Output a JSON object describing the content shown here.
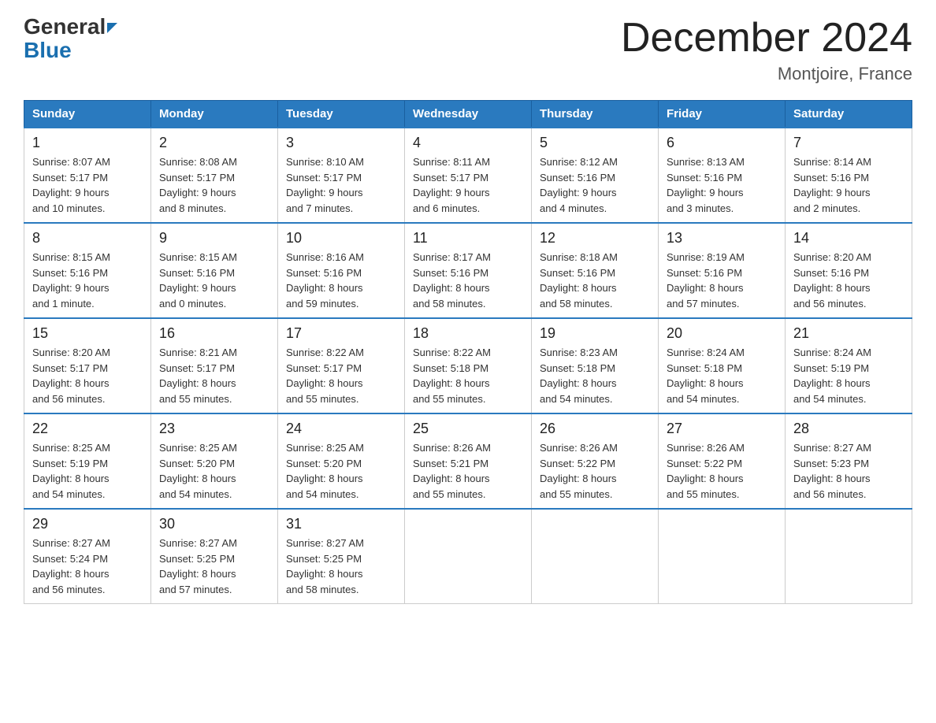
{
  "logo": {
    "general": "General",
    "blue": "Blue"
  },
  "title": "December 2024",
  "subtitle": "Montjoire, France",
  "days_of_week": [
    "Sunday",
    "Monday",
    "Tuesday",
    "Wednesday",
    "Thursday",
    "Friday",
    "Saturday"
  ],
  "weeks": [
    [
      {
        "day": "1",
        "sunrise": "8:07 AM",
        "sunset": "5:17 PM",
        "daylight": "9 hours and 10 minutes."
      },
      {
        "day": "2",
        "sunrise": "8:08 AM",
        "sunset": "5:17 PM",
        "daylight": "9 hours and 8 minutes."
      },
      {
        "day": "3",
        "sunrise": "8:10 AM",
        "sunset": "5:17 PM",
        "daylight": "9 hours and 7 minutes."
      },
      {
        "day": "4",
        "sunrise": "8:11 AM",
        "sunset": "5:17 PM",
        "daylight": "9 hours and 6 minutes."
      },
      {
        "day": "5",
        "sunrise": "8:12 AM",
        "sunset": "5:16 PM",
        "daylight": "9 hours and 4 minutes."
      },
      {
        "day": "6",
        "sunrise": "8:13 AM",
        "sunset": "5:16 PM",
        "daylight": "9 hours and 3 minutes."
      },
      {
        "day": "7",
        "sunrise": "8:14 AM",
        "sunset": "5:16 PM",
        "daylight": "9 hours and 2 minutes."
      }
    ],
    [
      {
        "day": "8",
        "sunrise": "8:15 AM",
        "sunset": "5:16 PM",
        "daylight": "9 hours and 1 minute."
      },
      {
        "day": "9",
        "sunrise": "8:15 AM",
        "sunset": "5:16 PM",
        "daylight": "9 hours and 0 minutes."
      },
      {
        "day": "10",
        "sunrise": "8:16 AM",
        "sunset": "5:16 PM",
        "daylight": "8 hours and 59 minutes."
      },
      {
        "day": "11",
        "sunrise": "8:17 AM",
        "sunset": "5:16 PM",
        "daylight": "8 hours and 58 minutes."
      },
      {
        "day": "12",
        "sunrise": "8:18 AM",
        "sunset": "5:16 PM",
        "daylight": "8 hours and 58 minutes."
      },
      {
        "day": "13",
        "sunrise": "8:19 AM",
        "sunset": "5:16 PM",
        "daylight": "8 hours and 57 minutes."
      },
      {
        "day": "14",
        "sunrise": "8:20 AM",
        "sunset": "5:16 PM",
        "daylight": "8 hours and 56 minutes."
      }
    ],
    [
      {
        "day": "15",
        "sunrise": "8:20 AM",
        "sunset": "5:17 PM",
        "daylight": "8 hours and 56 minutes."
      },
      {
        "day": "16",
        "sunrise": "8:21 AM",
        "sunset": "5:17 PM",
        "daylight": "8 hours and 55 minutes."
      },
      {
        "day": "17",
        "sunrise": "8:22 AM",
        "sunset": "5:17 PM",
        "daylight": "8 hours and 55 minutes."
      },
      {
        "day": "18",
        "sunrise": "8:22 AM",
        "sunset": "5:18 PM",
        "daylight": "8 hours and 55 minutes."
      },
      {
        "day": "19",
        "sunrise": "8:23 AM",
        "sunset": "5:18 PM",
        "daylight": "8 hours and 54 minutes."
      },
      {
        "day": "20",
        "sunrise": "8:24 AM",
        "sunset": "5:18 PM",
        "daylight": "8 hours and 54 minutes."
      },
      {
        "day": "21",
        "sunrise": "8:24 AM",
        "sunset": "5:19 PM",
        "daylight": "8 hours and 54 minutes."
      }
    ],
    [
      {
        "day": "22",
        "sunrise": "8:25 AM",
        "sunset": "5:19 PM",
        "daylight": "8 hours and 54 minutes."
      },
      {
        "day": "23",
        "sunrise": "8:25 AM",
        "sunset": "5:20 PM",
        "daylight": "8 hours and 54 minutes."
      },
      {
        "day": "24",
        "sunrise": "8:25 AM",
        "sunset": "5:20 PM",
        "daylight": "8 hours and 54 minutes."
      },
      {
        "day": "25",
        "sunrise": "8:26 AM",
        "sunset": "5:21 PM",
        "daylight": "8 hours and 55 minutes."
      },
      {
        "day": "26",
        "sunrise": "8:26 AM",
        "sunset": "5:22 PM",
        "daylight": "8 hours and 55 minutes."
      },
      {
        "day": "27",
        "sunrise": "8:26 AM",
        "sunset": "5:22 PM",
        "daylight": "8 hours and 55 minutes."
      },
      {
        "day": "28",
        "sunrise": "8:27 AM",
        "sunset": "5:23 PM",
        "daylight": "8 hours and 56 minutes."
      }
    ],
    [
      {
        "day": "29",
        "sunrise": "8:27 AM",
        "sunset": "5:24 PM",
        "daylight": "8 hours and 56 minutes."
      },
      {
        "day": "30",
        "sunrise": "8:27 AM",
        "sunset": "5:25 PM",
        "daylight": "8 hours and 57 minutes."
      },
      {
        "day": "31",
        "sunrise": "8:27 AM",
        "sunset": "5:25 PM",
        "daylight": "8 hours and 58 minutes."
      },
      null,
      null,
      null,
      null
    ]
  ],
  "labels": {
    "sunrise": "Sunrise:",
    "sunset": "Sunset:",
    "daylight": "Daylight:"
  }
}
